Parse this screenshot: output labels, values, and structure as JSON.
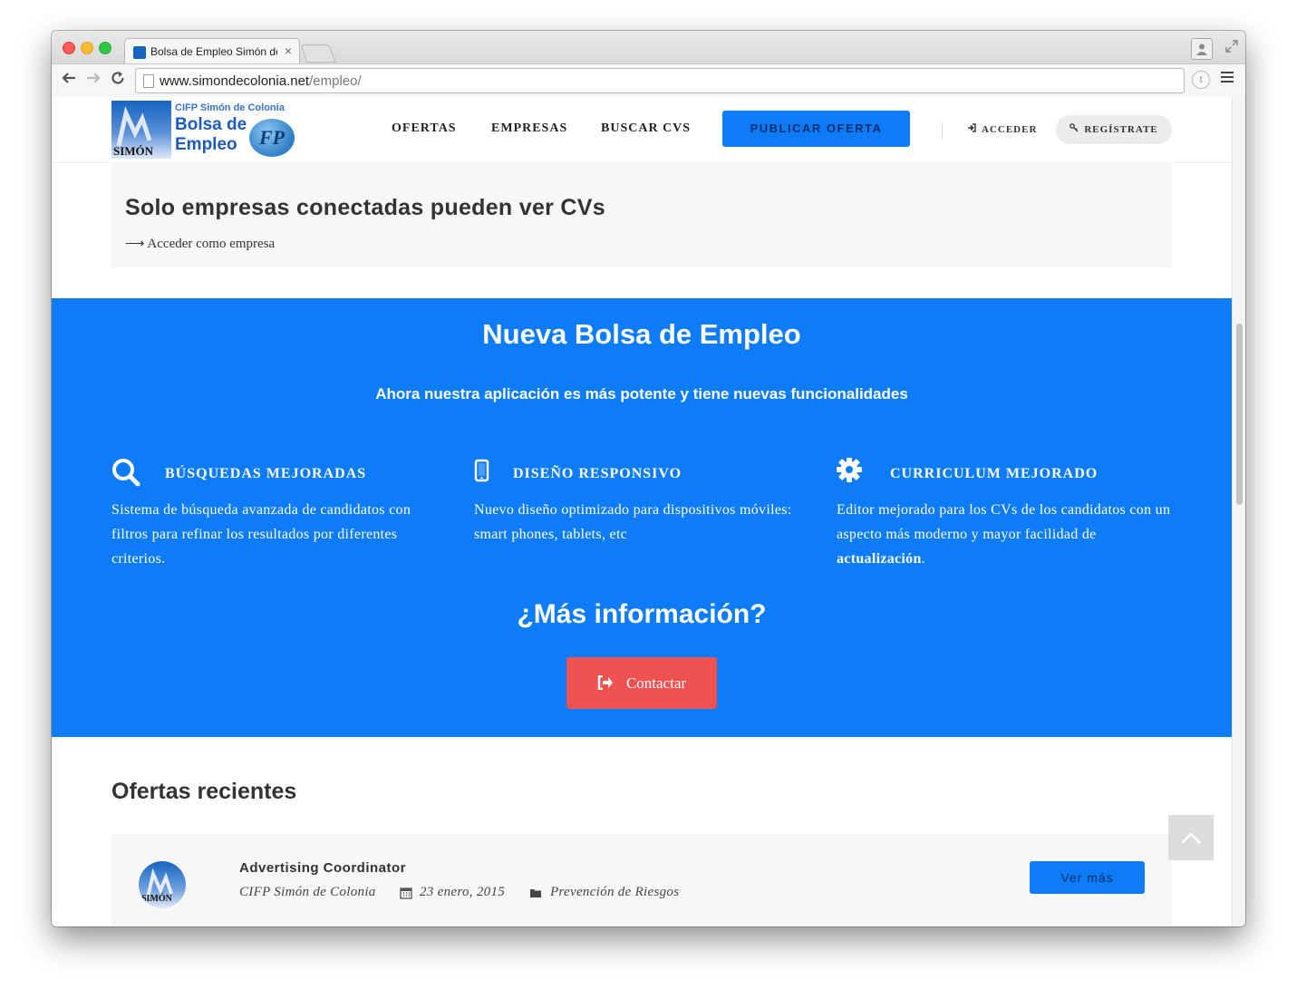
{
  "browser": {
    "tab_title": "Bolsa de Empleo Simón de",
    "tab_close": "×",
    "url_host": "www.simondecolonia.net",
    "url_path": "/empleo/",
    "ext_letter": "t"
  },
  "header": {
    "logo_top": "CIFP Simón de Colonia",
    "logo_main": "Bolsa de Empleo",
    "logo_sim": "SIMÓN",
    "logo_fp": "FP",
    "nav": [
      "OFERTAS",
      "EMPRESAS",
      "BUSCAR CVS"
    ],
    "publish_label": "PUBLICAR OFERTA",
    "login_label": "ACCEDER",
    "register_label": "REGÍSTRATE"
  },
  "notice": {
    "title": "Solo empresas conectadas pueden ver CVs",
    "link": "⟶ Acceder como empresa"
  },
  "band": {
    "title": "Nueva Bolsa de Empleo",
    "subtitle": "Ahora nuestra aplicación es más potente y tiene nuevas funcionalidades",
    "features": [
      {
        "icon": "search-icon",
        "title": "BÚSQUEDAS  MEJORADAS",
        "text": "Sistema de búsqueda avanzada de candidatos con filtros para refinar los resultados por diferentes criterios."
      },
      {
        "icon": "mobile-icon",
        "title": "DISEÑO RESPONSIVO",
        "text": "Nuevo diseño optimizado para dispositivos móviles: smart phones, tablets, etc"
      },
      {
        "icon": "gear-icon",
        "title": "CURRICULUM MEJORADO",
        "text_before": "Editor mejorado para los CVs de los candidatos con un aspecto más moderno y mayor facilidad de ",
        "text_bold": "actualización",
        "text_after": "."
      }
    ],
    "question": "¿Más información?",
    "contact_label": "Contactar"
  },
  "recent": {
    "title": "Ofertas recientes",
    "offers": [
      {
        "title": "Advertising Coordinator",
        "company": "CIFP Simón de Colonia",
        "date": "23 enero, 2015",
        "category": "Prevención de Riesgos",
        "button": "Ver más"
      }
    ]
  },
  "colors": {
    "accent_blue": "#0d7cf6",
    "contact_red": "#f05252",
    "notice_bg": "#f7f7f7"
  }
}
